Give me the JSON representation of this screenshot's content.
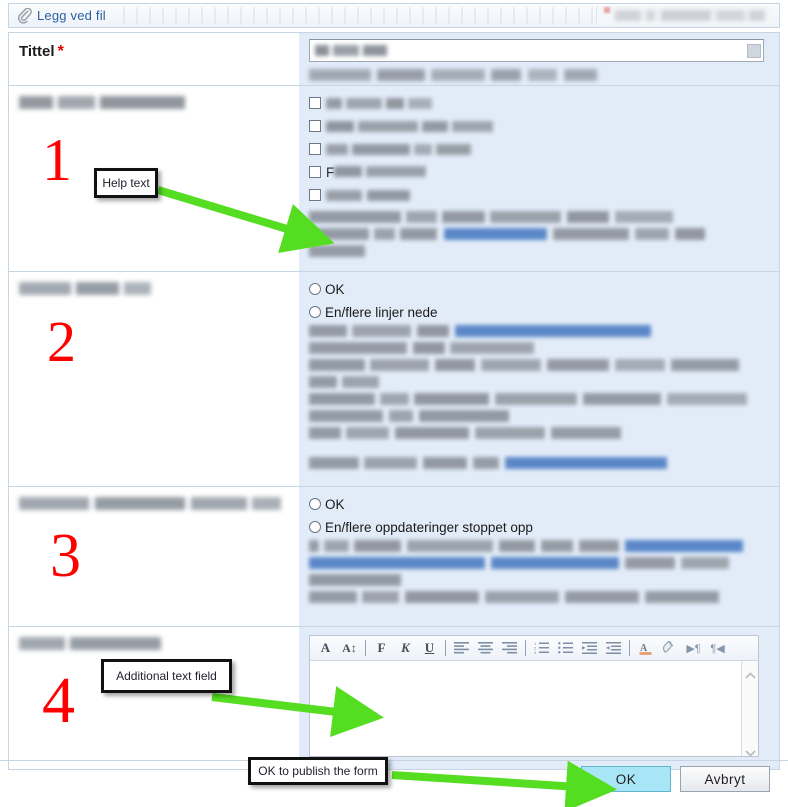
{
  "window": {
    "attach": {
      "label": "Legg ved fil",
      "icon": "paperclip-icon"
    },
    "required_marker": "*"
  },
  "form": {
    "rows": [
      {
        "id": "tittel",
        "label": "Tittel",
        "required": true,
        "field_type": "text-with-picker"
      },
      {
        "id": "section1",
        "label_redacted": true,
        "field_type": "checkbox-group",
        "options": [
          {
            "redacted": true
          },
          {
            "redacted": true
          },
          {
            "redacted": true
          },
          {
            "redacted": true,
            "visible_fragment": "F"
          },
          {
            "redacted": true
          }
        ]
      },
      {
        "id": "section2",
        "label_redacted": true,
        "field_type": "radio-group",
        "options": [
          {
            "label": "OK"
          },
          {
            "label": "En/flere linjer nede"
          }
        ]
      },
      {
        "id": "section3",
        "label_redacted": true,
        "field_type": "radio-group",
        "options": [
          {
            "label": "OK"
          },
          {
            "label": "En/flere oppdateringer stoppet opp"
          }
        ]
      },
      {
        "id": "section4",
        "label_redacted": true,
        "field_type": "rich-text-editor"
      }
    ]
  },
  "editor": {
    "toolbar": [
      {
        "name": "font-family-icon",
        "glyph": "A"
      },
      {
        "name": "font-size-icon",
        "glyph": "A↕"
      },
      {
        "name": "bold-icon",
        "glyph": "F"
      },
      {
        "name": "italic-icon",
        "glyph": "K"
      },
      {
        "name": "underline-icon",
        "glyph": "U"
      },
      {
        "name": "align-left-icon",
        "glyph": "≡"
      },
      {
        "name": "align-center-icon",
        "glyph": "≡"
      },
      {
        "name": "align-right-icon",
        "glyph": "≡"
      },
      {
        "name": "ordered-list-icon",
        "glyph": "1."
      },
      {
        "name": "unordered-list-icon",
        "glyph": "•"
      },
      {
        "name": "indent-icon",
        "glyph": "⇥"
      },
      {
        "name": "outdent-icon",
        "glyph": "⇤"
      },
      {
        "name": "text-color-icon",
        "glyph": "A"
      },
      {
        "name": "highlight-color-icon",
        "glyph": "◑"
      },
      {
        "name": "ltr-direction-icon",
        "glyph": "▶¶"
      },
      {
        "name": "rtl-direction-icon",
        "glyph": "¶◀"
      }
    ],
    "content": ""
  },
  "buttons": {
    "ok": "OK",
    "cancel": "Avbryt"
  },
  "annotations": {
    "numbers": [
      "1",
      "2",
      "3",
      "4"
    ],
    "callouts": [
      {
        "id": "help-text",
        "text": "Help text"
      },
      {
        "id": "additional-text-field",
        "text": "Additional text field"
      },
      {
        "id": "ok-publish",
        "text": "OK to publish the form"
      }
    ],
    "arrow_color": "#55dd22"
  },
  "colors": {
    "field_background": "#e2ecf9",
    "accent_blue": "#2b5f9e",
    "required_red": "#e00000",
    "annotation_green": "#55dd22",
    "annotation_red": "#ff0000",
    "ok_button": "#a8e6f7"
  }
}
